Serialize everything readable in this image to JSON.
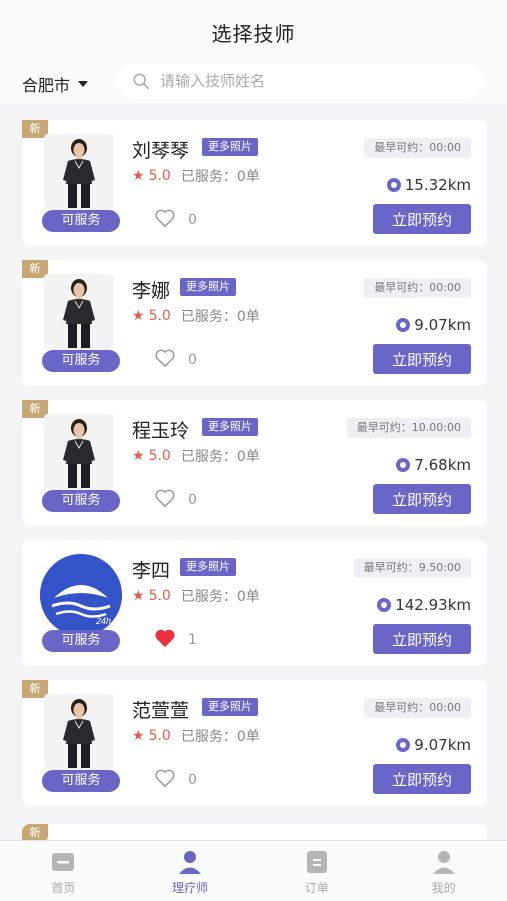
{
  "header": {
    "title": "选择技师",
    "city": "合肥市",
    "search_placeholder": "请输入技师姓名"
  },
  "therapists": [
    {
      "new_badge": "新",
      "name": "刘琴琴",
      "more_photos": "更多照片",
      "rating": "5.0",
      "served": "已服务：0单",
      "likes": "0",
      "liked": false,
      "earliest": "最早可约：00:00",
      "distance": "15.32km",
      "status": "可服务",
      "book": "立即预约",
      "avatar": "woman-photo"
    },
    {
      "new_badge": "新",
      "name": "李娜",
      "more_photos": "更多照片",
      "rating": "5.0",
      "served": "已服务：0单",
      "likes": "0",
      "liked": false,
      "earliest": "最早可约：00:00",
      "distance": "9.07km",
      "status": "可服务",
      "book": "立即预约",
      "avatar": "woman-photo"
    },
    {
      "new_badge": "新",
      "name": "程玉玲",
      "more_photos": "更多照片",
      "rating": "5.0",
      "served": "已服务：0单",
      "likes": "0",
      "liked": false,
      "earliest": "最早可约：10.00:00",
      "distance": "7.68km",
      "status": "可服务",
      "book": "立即预约",
      "avatar": "woman-photo"
    },
    {
      "new_badge": "",
      "name": "李四",
      "more_photos": "更多照片",
      "rating": "5.0",
      "served": "已服务：0单",
      "likes": "1",
      "liked": true,
      "earliest": "最早可约：9.50:00",
      "distance": "142.93km",
      "status": "可服务",
      "book": "立即预约",
      "avatar": "logo-24h"
    },
    {
      "new_badge": "新",
      "name": "范萱萱",
      "more_photos": "更多照片",
      "rating": "5.0",
      "served": "已服务：0单",
      "likes": "0",
      "liked": false,
      "earliest": "最早可约：00:00",
      "distance": "9.07km",
      "status": "可服务",
      "book": "立即预约",
      "avatar": "woman-photo"
    }
  ],
  "partial_card": {
    "new_badge": "新"
  },
  "tabbar": {
    "tabs": [
      {
        "label": "首页",
        "icon": "home-icon",
        "active": false
      },
      {
        "label": "理疗师",
        "icon": "therapist-icon",
        "active": true
      },
      {
        "label": "订单",
        "icon": "order-icon",
        "active": false
      },
      {
        "label": "我的",
        "icon": "user-icon",
        "active": false
      }
    ]
  },
  "colors": {
    "accent": "#6a66c8",
    "star": "#e25c4b",
    "new_badge": "#c8a774",
    "heart_liked": "#e8333f"
  }
}
